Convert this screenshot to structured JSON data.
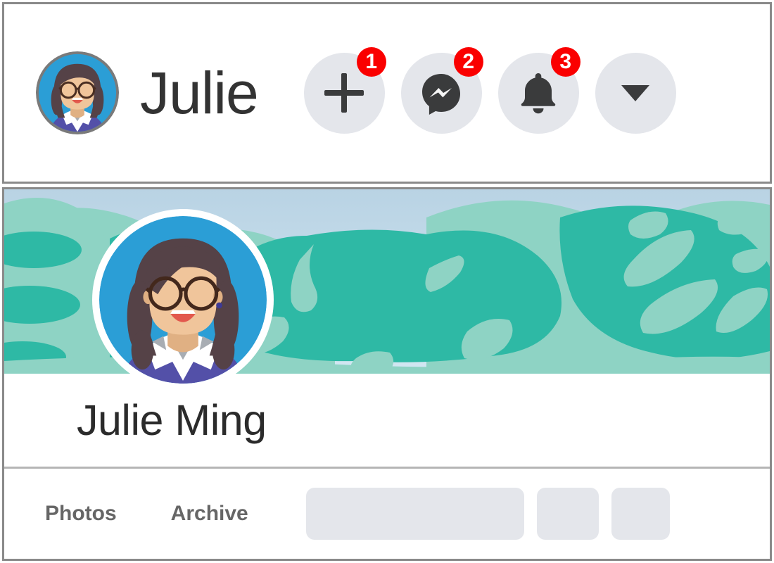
{
  "header": {
    "avatar": {
      "icon": "user-avatar-julie",
      "alt": "Julie profile photo"
    },
    "title": "Julie",
    "actions": [
      {
        "name": "create-button",
        "icon": "plus-icon",
        "badge": "1"
      },
      {
        "name": "messenger-button",
        "icon": "messenger-icon",
        "badge": "2"
      },
      {
        "name": "notifications-button",
        "icon": "bell-icon",
        "badge": "3"
      },
      {
        "name": "account-menu-button",
        "icon": "chevron-down-icon",
        "badge": ""
      }
    ]
  },
  "profile": {
    "cover_photo": {
      "icon": "tropical-leaves-cover",
      "alt": "Tropical leaf cover photo"
    },
    "avatar": {
      "icon": "user-avatar-julie",
      "alt": "Julie Ming profile photo"
    },
    "name": "Julie Ming",
    "tabs": [
      {
        "name": "tab-photos",
        "label": "Photos"
      },
      {
        "name": "tab-archive",
        "label": "Archive"
      }
    ],
    "placeholders": [
      {
        "name": "placeholder-wide"
      },
      {
        "name": "placeholder-square-1"
      },
      {
        "name": "placeholder-square-2"
      }
    ]
  },
  "colors": {
    "badge_red": "#fa0000",
    "button_grey": "#e4e6eb",
    "icon_dark": "#3a3b3c",
    "border_grey": "#8a8a8a",
    "tab_text": "#666666",
    "cover_teal": "#2eb9a5",
    "cover_mint": "#8ed3c4",
    "cover_sky": "#bfdcea",
    "avatar_blue": "#2b9ed6",
    "hair_brown": "#554247",
    "skin": "#f0c59b",
    "lips_red": "#e2584d",
    "shirt_purple": "#5350a8"
  }
}
